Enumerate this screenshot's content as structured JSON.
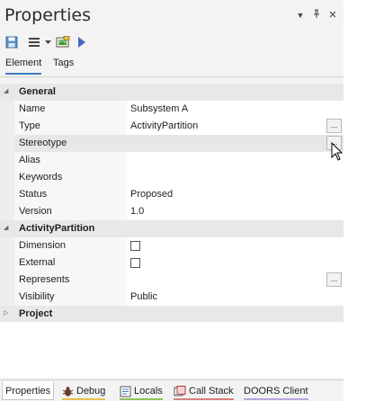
{
  "window": {
    "title": "Properties"
  },
  "titlebar_buttons": {
    "menu": "▼",
    "pin": "⊥",
    "close": "✕"
  },
  "toolbar": {
    "icons": [
      "save-icon",
      "list-menu-icon",
      "dropdown-arrow-icon",
      "image-icon",
      "play-icon"
    ],
    "colors": {
      "save": "#5b8fc7",
      "play": "#4a63c9"
    }
  },
  "tabs": [
    {
      "label": "Element",
      "active": true
    },
    {
      "label": "Tags",
      "active": false
    }
  ],
  "groups": {
    "general": {
      "label": "General",
      "rows": [
        {
          "name": "Name",
          "value": "Subsystem A"
        },
        {
          "name": "Type",
          "value": "ActivityPartition"
        },
        {
          "name": "Stereotype",
          "value": ""
        },
        {
          "name": "Alias",
          "value": ""
        },
        {
          "name": "Keywords",
          "value": ""
        },
        {
          "name": "Status",
          "value": "Proposed"
        },
        {
          "name": "Version",
          "value": "1.0"
        }
      ]
    },
    "activity_partition": {
      "label": "ActivityPartition",
      "rows": [
        {
          "name": "Dimension",
          "value": "",
          "checked": false
        },
        {
          "name": "External",
          "value": "",
          "checked": false
        },
        {
          "name": "Represents",
          "value": ""
        },
        {
          "name": "Visibility",
          "value": "Public"
        }
      ]
    },
    "project": {
      "label": "Project"
    }
  },
  "ellipsis_label": "...",
  "bottom_tabs": [
    {
      "label": "Properties",
      "active": true,
      "underline": ""
    },
    {
      "label": "Debug",
      "active": false,
      "underline": "#e8c24a"
    },
    {
      "label": "Locals",
      "active": false,
      "underline": "#8fc45a"
    },
    {
      "label": "Call Stack",
      "active": false,
      "underline": "#d98080"
    },
    {
      "label": "DOORS Client",
      "active": false,
      "underline": "#b9a6dc"
    }
  ]
}
